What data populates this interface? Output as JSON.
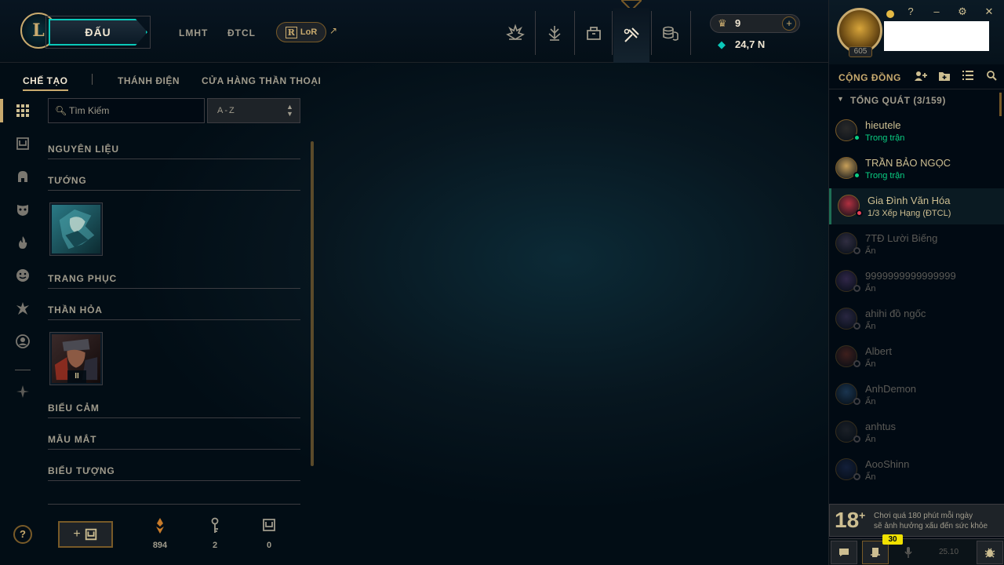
{
  "topbar": {
    "play_label": "ĐẤU",
    "nav_links": [
      "LMHT",
      "ĐTCL"
    ],
    "lor_label": "LoR",
    "lor_r": "R",
    "ext_arrow": "↗",
    "nav_icons": [
      "home-icon",
      "clash-icon",
      "loot-icon",
      "crafting-icon",
      "store-icon"
    ],
    "active_icon": "crafting-icon",
    "rp_value": "9",
    "be_value": "24,7 N",
    "plus": "+"
  },
  "profile": {
    "level": "605"
  },
  "window_controls": [
    "?",
    "–",
    "⚙",
    "✕"
  ],
  "collection": {
    "tabs": [
      "CHẾ TẠO",
      "THÁNH ĐIỆN",
      "CỬA HÀNG THẦN THOẠI"
    ],
    "active_tab": "CHẾ TẠO",
    "search_placeholder": "Tìm Kiếm",
    "sort_value": "A-Z",
    "categories": [
      "NGUYÊN LIỆU",
      "TƯỚNG",
      "TRANG PHỤC",
      "THẦN HỎA",
      "BIỂU CẢM",
      "MẪU MẮT",
      "BIỂU TƯỢNG"
    ],
    "pause_label": "II"
  },
  "resources": {
    "essence": "894",
    "keys": "2",
    "chests": "0"
  },
  "help_label": "?",
  "craft_label": "+",
  "social": {
    "title": "CỘNG ĐỒNG",
    "group_label": "TỔNG QUÁT (3/159)",
    "friends": [
      {
        "name": "hieutele",
        "status": "Trong trận",
        "state": "ingame"
      },
      {
        "name": "TRẦN BẢO NGỌC",
        "status": "Trong trận",
        "state": "ingame"
      },
      {
        "name": "Gia Đình Văn Hóa",
        "status": "1/3 Xếp Hạng (ĐTCL)",
        "state": "away"
      },
      {
        "name": "7TĐ Lười Biếng",
        "status": "Ẩn",
        "state": "offline"
      },
      {
        "name": "9999999999999999",
        "status": "Ẩn",
        "state": "offline"
      },
      {
        "name": "ahihi đồ ngốc",
        "status": "Ẩn",
        "state": "offline"
      },
      {
        "name": "Albert",
        "status": "Ẩn",
        "state": "offline"
      },
      {
        "name": "AnhDemon",
        "status": "Ẩn",
        "state": "offline"
      },
      {
        "name": "anhtus",
        "status": "Ẩn",
        "state": "offline"
      },
      {
        "name": "AooShinn",
        "status": "Ẩn",
        "state": "offline"
      }
    ],
    "warning_18": "18",
    "warning_plus": "+",
    "warning_line1": "Chơi quá 180 phút mỗi ngày",
    "warning_line2": "sẽ ảnh hưởng xấu đến sức khỏe",
    "badge": "30",
    "version": "25.10"
  },
  "colors": {
    "gold": "#c8aa6e",
    "teal": "#0ac8b9",
    "ingame": "#0acf83",
    "away": "#e84057"
  }
}
